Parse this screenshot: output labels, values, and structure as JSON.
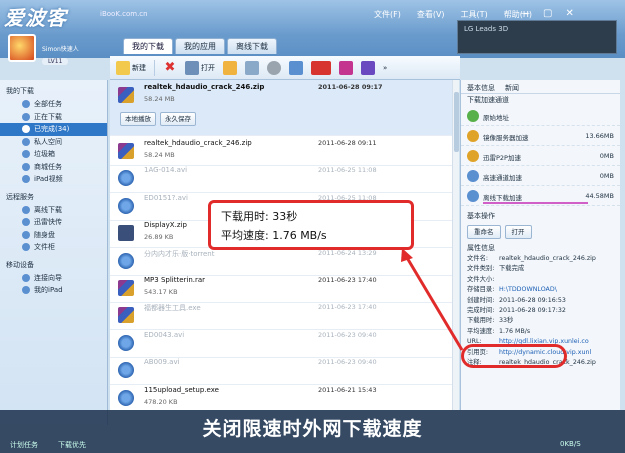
{
  "title": {
    "watermark": "爱波客",
    "watermark_url": "iBooK.com.cn",
    "menu": [
      "文件(F)",
      "查看(V)",
      "工具(T)",
      "帮助(H)"
    ],
    "ad": "LG Leads 3D"
  },
  "user": {
    "name": "Simon快速人",
    "level": "LV11"
  },
  "sidebar": {
    "groups": [
      {
        "label": "我的下载",
        "items": [
          {
            "label": "全部任务",
            "active": false
          },
          {
            "label": "正在下载",
            "active": false
          },
          {
            "label": "已完成(34)",
            "active": true
          },
          {
            "label": "私人空间",
            "active": false
          },
          {
            "label": "垃圾箱",
            "active": false
          },
          {
            "label": "商城任务",
            "active": false
          },
          {
            "label": "iPad视频",
            "active": false
          }
        ]
      },
      {
        "label": "远程服务",
        "items": [
          {
            "label": "离线下载",
            "active": false
          },
          {
            "label": "迅雷快传",
            "active": false
          },
          {
            "label": "随身盘",
            "active": false
          },
          {
            "label": "文件柜",
            "active": false
          }
        ]
      },
      {
        "label": "移动设备",
        "items": [
          {
            "label": "连接向导",
            "active": false
          },
          {
            "label": "我的iPad",
            "active": false
          }
        ]
      }
    ]
  },
  "tabs": [
    {
      "label": "我的下载",
      "active": true
    },
    {
      "label": "我的应用",
      "active": false
    },
    {
      "label": "离线下载",
      "active": false
    }
  ],
  "toolbar": {
    "new_label": "新建",
    "open_label": "打开"
  },
  "files": [
    {
      "name": "realtek_hdaudio_crack_246.zip",
      "size": "58.24 MB",
      "date": "2011-06-28 09:17",
      "icon": "rar",
      "selected": true,
      "faded": false
    },
    {
      "name": "realtek_hdaudio_crack_246.zip",
      "size": "58.24 MB",
      "date": "2011-06-28 09:11",
      "icon": "rar",
      "selected": false,
      "faded": false
    },
    {
      "name": "1AG-014.avi",
      "size": "",
      "date": "2011-06-25 11:08",
      "icon": "exe",
      "selected": false,
      "faded": true
    },
    {
      "name": "ED0151?.avi",
      "size": "",
      "date": "2011-06-25 11:08",
      "icon": "exe",
      "selected": false,
      "faded": true
    },
    {
      "name": "DisplayX.zip",
      "size": "26.89 KB",
      "date": "2011-06-24 13:29",
      "icon": "zip-doc",
      "selected": false,
      "faded": false
    },
    {
      "name": "分内内才乐·版·torrent",
      "size": "",
      "date": "2011-06-24 13:29",
      "icon": "exe",
      "selected": false,
      "faded": true
    },
    {
      "name": "MP3 Splitterin.rar",
      "size": "543.17 KB",
      "date": "2011-06-23 17:40",
      "icon": "rar",
      "selected": false,
      "faded": false
    },
    {
      "name": "福都器生工具.exe",
      "size": "",
      "date": "2011-06-23 17:40",
      "icon": "rar",
      "selected": false,
      "faded": true
    },
    {
      "name": "ED0043.avi",
      "size": "",
      "date": "2011-06-23 09:40",
      "icon": "exe",
      "selected": false,
      "faded": true
    },
    {
      "name": "AB009.avi",
      "size": "",
      "date": "2011-06-23 09:40",
      "icon": "exe",
      "selected": false,
      "faded": true
    },
    {
      "name": "115upload_setup.exe",
      "size": "478.20 KB",
      "date": "2011-06-21 15:43",
      "icon": "exe",
      "selected": false,
      "faded": false
    }
  ],
  "row_actions": {
    "local_label": "本地播放",
    "save_label": "永久保存"
  },
  "right_panel": {
    "tabs": [
      "基本信息",
      "新闻"
    ],
    "accel_title": "下载加速通道",
    "accel": [
      {
        "name": "原始地址",
        "value": "",
        "color": "#58b04a",
        "bar": 0
      },
      {
        "name": "镜像服务器加速",
        "value": "13.66MB",
        "color": "#e0a32a",
        "bar": 0
      },
      {
        "name": "迅雷P2P加速",
        "value": "0MB",
        "color": "#e0a32a",
        "bar": 0
      },
      {
        "name": "高速通道加速",
        "value": "0MB",
        "color": "#5a8fd0",
        "bar": 0
      },
      {
        "name": "离线下载加速",
        "value": "44.58MB",
        "color": "#5a8fd0",
        "bar": 0.95
      }
    ],
    "ops_title": "基本操作",
    "ops": [
      "重命名",
      "打开"
    ],
    "props_title": "属性信息",
    "props": [
      {
        "k": "文件名:",
        "v": "realtek_hdaudio_crack_246.zip",
        "link": false
      },
      {
        "k": "文件类别:",
        "v": "下载完成",
        "link": false
      },
      {
        "k": "文件大小:",
        "v": "",
        "link": false
      },
      {
        "k": "存储目录:",
        "v": "H:\\TDDOWNLOAD\\",
        "link": true
      },
      {
        "k": "创建时间:",
        "v": "2011-06-28 09:16:53",
        "link": false
      },
      {
        "k": "完成时间:",
        "v": "2011-06-28 09:17:32",
        "link": false
      },
      {
        "k": "下载用时:",
        "v": "33秒",
        "link": false
      },
      {
        "k": "平均速度:",
        "v": "1.76 MB/s",
        "link": false
      },
      {
        "k": "URL:",
        "v": "http://gdl.lixian.vip.xunlei.co",
        "link": true
      },
      {
        "k": "引用页:",
        "v": "http://dynamic.cloud.vip.xunl",
        "link": true
      },
      {
        "k": "注释:",
        "v": "realtek_hdaudio_crack_246.zip",
        "link": false
      }
    ]
  },
  "speed_popup": {
    "time_line": "下载用时: 33秒",
    "speed_line": "平均速度: 1.76 MB/s"
  },
  "caption": "关闭限速时外网下载速度",
  "statusbar": {
    "left": [
      "计划任务",
      "下载优先"
    ],
    "right": "0KB/S"
  }
}
